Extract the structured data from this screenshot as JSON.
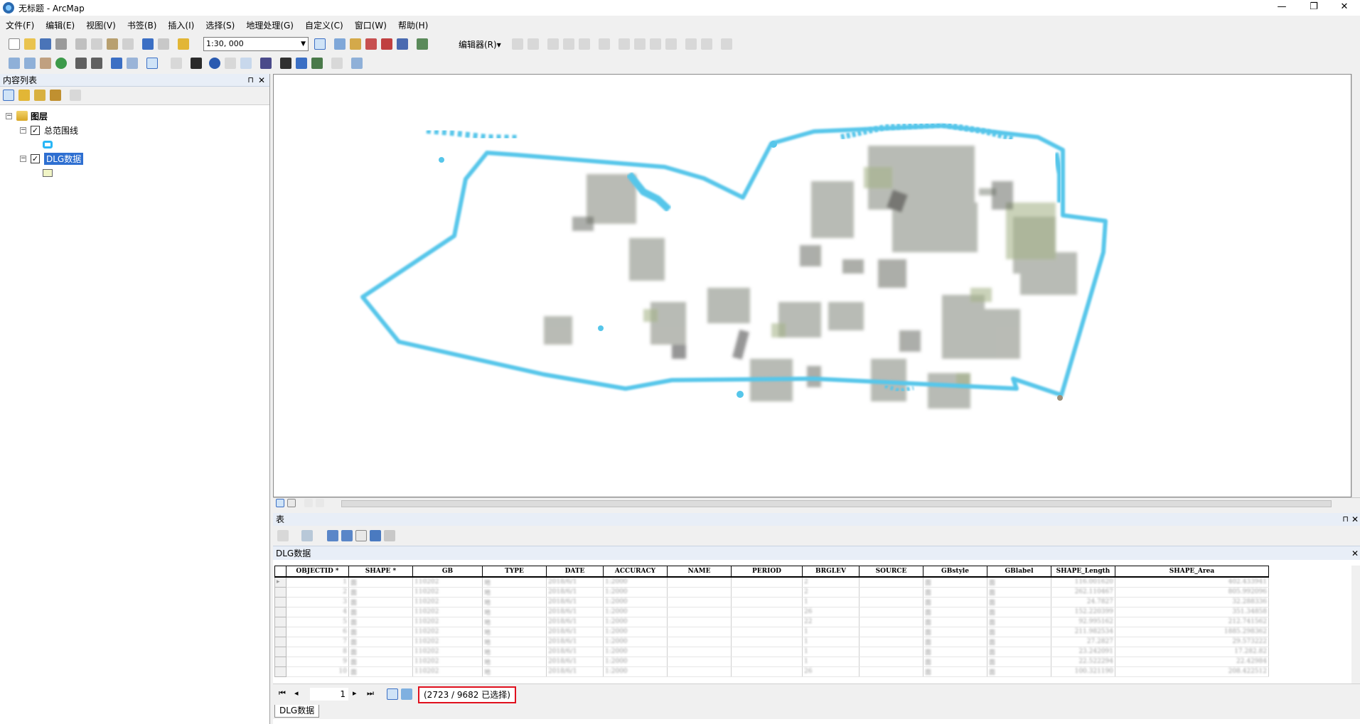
{
  "window": {
    "title": "无标题 - ArcMap",
    "minimize": "—",
    "restore": "❐",
    "close": "✕"
  },
  "menubar": [
    "文件(F)",
    "编辑(E)",
    "视图(V)",
    "书签(B)",
    "插入(I)",
    "选择(S)",
    "地理处理(G)",
    "自定义(C)",
    "窗口(W)",
    "帮助(H)"
  ],
  "toolbar": {
    "scale_value": "1:30, 000",
    "editor_label": "编辑器(R)▾"
  },
  "toc": {
    "title": "内容列表",
    "pin": "⊓",
    "close": "✕",
    "root_label": "图层",
    "layers": [
      {
        "name": "总范围线",
        "checked": true,
        "symbol_color": "#29b6f6"
      },
      {
        "name": "DLG数据",
        "checked": true,
        "selected": true,
        "symbol_color": "#f1f5c6"
      }
    ]
  },
  "table_panel": {
    "title": "表",
    "pin": "⊓",
    "close": "✕",
    "tab_title": "DLG数据",
    "columns": [
      "OBJECTID *",
      "SHAPE *",
      "GB",
      "TYPE",
      "DATE",
      "ACCURACY",
      "NAME",
      "PERIOD",
      "BRGLEV",
      "SOURCE",
      "GBstyle",
      "GBlabel",
      "SHAPE_Length",
      "SHAPE_Area"
    ],
    "rows": [
      [
        "1",
        "面",
        "110202",
        "地",
        "2018/6/1",
        "1:2000",
        "",
        "",
        "2",
        "",
        "面",
        "面",
        "116.001620",
        "402.433941"
      ],
      [
        "2",
        "面",
        "110202",
        "地",
        "2018/6/1",
        "1:2000",
        "",
        "",
        "2",
        "",
        "面",
        "面",
        "262.110467",
        "805.992096"
      ],
      [
        "3",
        "面",
        "110202",
        "地",
        "2018/6/1",
        "1:2000",
        "",
        "",
        "1",
        "",
        "面",
        "面",
        "24.7827",
        "32.288336"
      ],
      [
        "4",
        "面",
        "110202",
        "地",
        "2018/6/1",
        "1:2000",
        "",
        "",
        "26",
        "",
        "面",
        "面",
        "152.220399",
        "351.34858"
      ],
      [
        "5",
        "面",
        "110202",
        "地",
        "2018/6/1",
        "1:2000",
        "",
        "",
        "22",
        "",
        "面",
        "面",
        "92.995162",
        "212.741562"
      ],
      [
        "6",
        "面",
        "110202",
        "地",
        "2018/6/1",
        "1:2000",
        "",
        "",
        "1",
        "",
        "面",
        "面",
        "211.982534",
        "1885.298362"
      ],
      [
        "7",
        "面",
        "110202",
        "地",
        "2018/6/1",
        "1:2000",
        "",
        "",
        "1",
        "",
        "面",
        "面",
        "27.2827",
        "29.573222"
      ],
      [
        "8",
        "面",
        "110202",
        "地",
        "2018/6/1",
        "1:2000",
        "",
        "",
        "1",
        "",
        "面",
        "面",
        "23.242091",
        "17.282.82"
      ],
      [
        "9",
        "面",
        "110202",
        "地",
        "2018/6/1",
        "1:2000",
        "",
        "",
        "1",
        "",
        "面",
        "面",
        "22.522294",
        "22.42984"
      ],
      [
        "10",
        "面",
        "110202",
        "地",
        "2018/6/1",
        "1:2000",
        "",
        "",
        "26",
        "",
        "面",
        "面",
        "100.321190",
        "208.422512"
      ]
    ],
    "page_number": "1",
    "selection_status": "(2723 / 9682 已选择)",
    "bottom_tab": "DLG数据"
  },
  "icons": [
    "new-icon",
    "open-icon",
    "save-icon",
    "print-icon",
    "cut-icon",
    "copy-icon",
    "paste-icon",
    "delete-icon",
    "undo-icon",
    "redo-icon",
    "add-data-icon",
    "zoom-in-icon",
    "zoom-out-icon",
    "pan-icon",
    "full-extent-icon",
    "identify-icon",
    "find-icon",
    "select-icon",
    "pin-icon",
    "close-icon"
  ],
  "colors": {
    "boundary": "#3cbfe8",
    "selection_highlight": "#2e6fd1",
    "status_border": "#e0101e"
  }
}
